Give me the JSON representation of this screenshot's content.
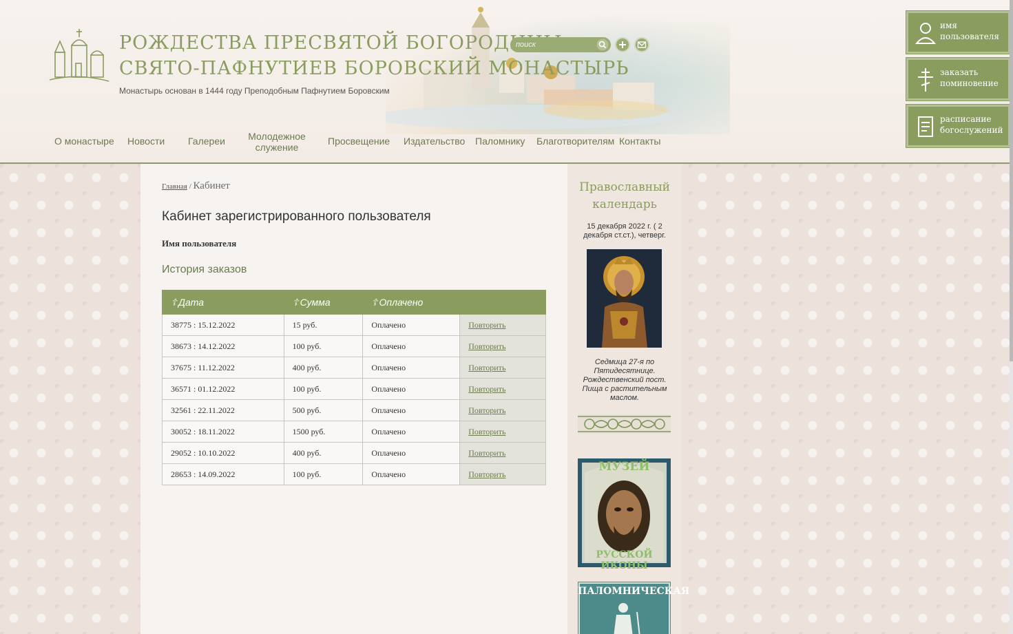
{
  "header": {
    "title_line1": "Рождества Пресвятой Богородицы",
    "title_line2": "Свято-Пафнутиев Боровский монастырь",
    "subtitle": "Монастырь основан в 1444 году Преподобным Пафнутием Боровским",
    "search_placeholder": "поиск"
  },
  "nav": [
    "О монастыре",
    "Новости",
    "Галереи",
    "Молодежное служение",
    "Просвещение",
    "Издательство",
    "Паломнику",
    "Благотворителям",
    "Контакты"
  ],
  "actions": {
    "user": "Имя пользователя",
    "commemoration": "Заказать поминовение",
    "schedule": "Расписание богослужений"
  },
  "breadcrumb": {
    "home": "Главная",
    "separator": "/",
    "current": "Кабинет"
  },
  "page": {
    "title": "Кабинет зарегистрированного пользователя",
    "user_name": "Имя пользователя",
    "history_title": "История заказов"
  },
  "table": {
    "headers": [
      "Дата",
      "Сумма",
      "Оплачено"
    ],
    "rows": [
      {
        "id_date": "38775 : 15.12.2022",
        "sum": "15 руб.",
        "paid": "Оплачено",
        "action": "Повторить"
      },
      {
        "id_date": "38673 : 14.12.2022",
        "sum": "100 руб.",
        "paid": "Оплачено",
        "action": "Повторить"
      },
      {
        "id_date": "37675 : 11.12.2022",
        "sum": "400 руб.",
        "paid": "Оплачено",
        "action": "Повторить"
      },
      {
        "id_date": "36571 : 01.12.2022",
        "sum": "100 руб.",
        "paid": "Оплачено",
        "action": "Повторить"
      },
      {
        "id_date": "32561 : 22.11.2022",
        "sum": "500 руб.",
        "paid": "Оплачено",
        "action": "Повторить"
      },
      {
        "id_date": "30052 : 18.11.2022",
        "sum": "1500 руб.",
        "paid": "Оплачено",
        "action": "Повторить"
      },
      {
        "id_date": "29052 : 10.10.2022",
        "sum": "400 руб.",
        "paid": "Оплачено",
        "action": "Повторить"
      },
      {
        "id_date": "28653 : 14.09.2022",
        "sum": "100 руб.",
        "paid": "Оплачено",
        "action": "Повторить"
      }
    ]
  },
  "calendar": {
    "title_line1": "Православный",
    "title_line2": "календарь",
    "date": "15 декабря 2022 г. ( 2 декабря ст.ст.), четверг.",
    "note": "Седмица 27-я по Пятидесятнице. Рождественский пост. Пища с растительным маслом."
  },
  "banners": {
    "museum_top": "Музей",
    "museum_bottom": "русской иконы",
    "pilgrim": "Паломническая"
  },
  "colors": {
    "accent": "#8a9c5e",
    "accent_light": "#b4c195",
    "nav_text": "#6b7a4f",
    "table_action_bg": "#e3e3dc"
  }
}
